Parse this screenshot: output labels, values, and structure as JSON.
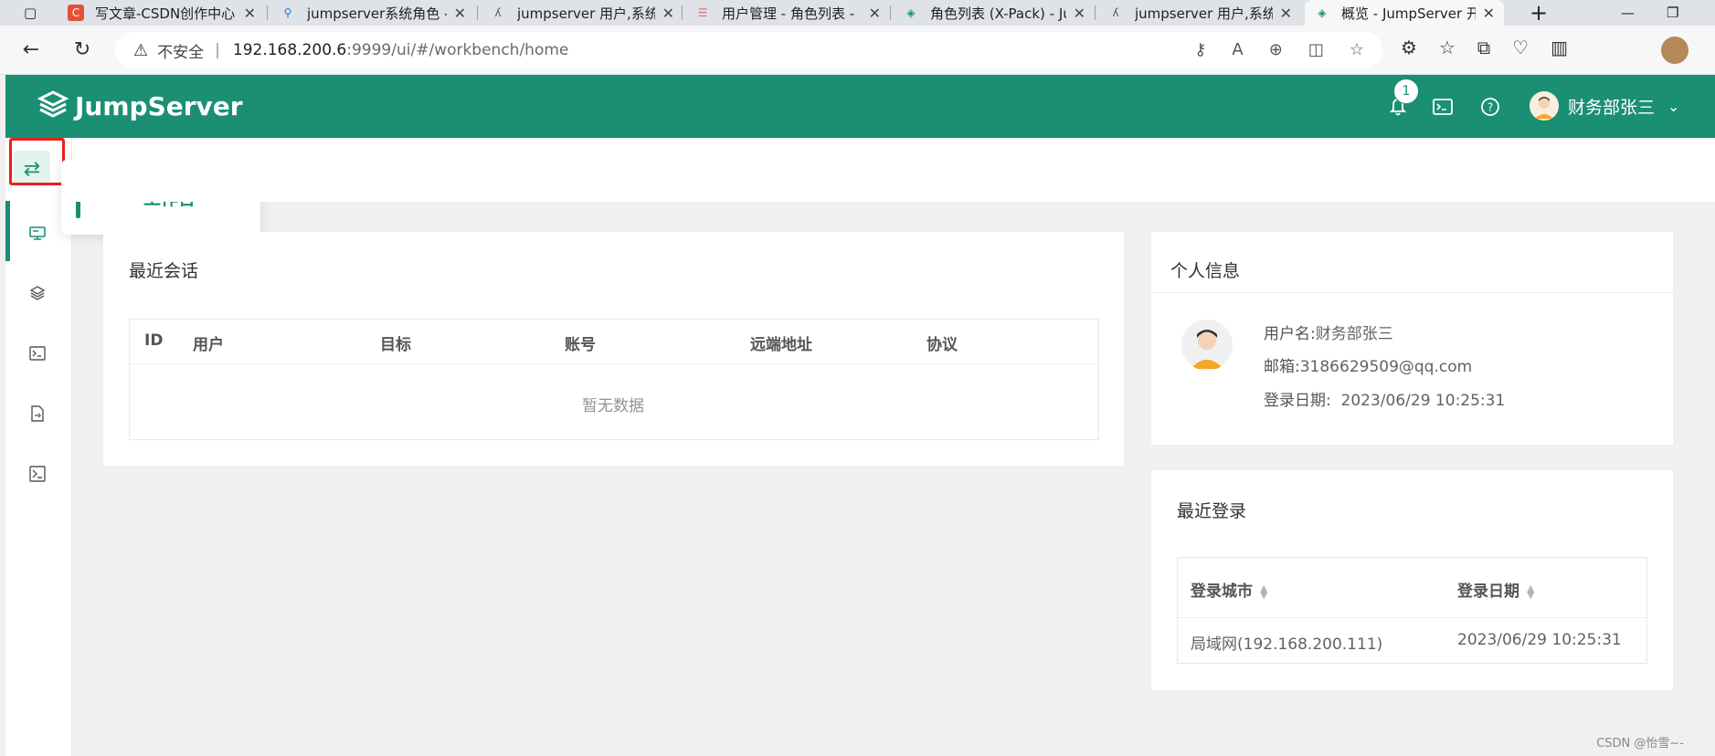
{
  "browser": {
    "tabs": [
      {
        "title": "写文章-CSDN创作中心",
        "favicon": "csdn-icon",
        "fav_color": "#e4503a"
      },
      {
        "title": "jumpserver系统角色 -",
        "favicon": "search-icon",
        "fav_color": "#1a73e8"
      },
      {
        "title": "jumpserver 用户,系统",
        "favicon": "doc-icon",
        "fav_color": "#555"
      },
      {
        "title": "用户管理 - 角色列表 -",
        "favicon": "page-icon",
        "fav_color": "#e57373"
      },
      {
        "title": "角色列表 (X-Pack) - Ju",
        "favicon": "jumpserver-icon",
        "fav_color": "#1a8f74"
      },
      {
        "title": "jumpserver 用户,系统",
        "favicon": "doc-icon",
        "fav_color": "#555"
      },
      {
        "title": "概览 - JumpServer 开",
        "favicon": "jumpserver-icon",
        "fav_color": "#1a8f74"
      }
    ],
    "address": {
      "warning": "不安全",
      "host": "192.168.200.6",
      "path": ":9999/ui/#/workbench/home"
    }
  },
  "header": {
    "logo_text": "JumpServer",
    "notification_count": "1",
    "username": "财务部张三",
    "accent": "#1a8f74"
  },
  "sidebar": {
    "popover_label": "工作台",
    "items": [
      "workbench-icon",
      "assets-icon",
      "terminal-icon",
      "file-icon",
      "command-icon"
    ]
  },
  "sessions": {
    "title": "最近会话",
    "columns": [
      "ID",
      "用户",
      "目标",
      "账号",
      "远端地址",
      "协议"
    ],
    "empty_text": "暂无数据"
  },
  "profile": {
    "title": "个人信息",
    "username_label": "用户名:",
    "username": "财务部张三",
    "email_label": "邮箱:",
    "email": "3186629509@qq.com",
    "date_label": "登录日期:",
    "date": "2023/06/29 10:25:31"
  },
  "logins": {
    "title": "最近登录",
    "columns": [
      "登录城市",
      "登录日期"
    ],
    "rows": [
      {
        "city": "局域网(192.168.200.111)",
        "date": "2023/06/29 10:25:31"
      }
    ]
  },
  "watermark": "CSDN @怡雪~-"
}
